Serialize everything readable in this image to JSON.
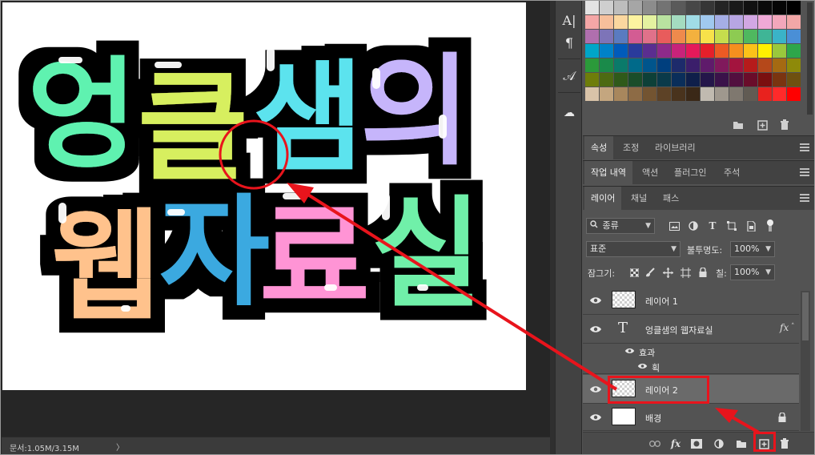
{
  "status": {
    "doc_info": "문서:1.05M/3.15M",
    "arrow": "〉"
  },
  "canvas": {
    "artwork": {
      "line1": [
        "엉",
        "클",
        "샘",
        "의"
      ],
      "line2": [
        "웹",
        "자",
        "료",
        "실"
      ],
      "colors": {
        "eong": "#5ef2b0",
        "keul": "#d7ef5f",
        "saem": "#5ce3ee",
        "ui": "#c6b5fb",
        "web": "#ffc28c",
        "ja": "#3aa9e0",
        "ryo": "#ff94d5",
        "sil": "#6ff0a9",
        "outline": "#000000",
        "shine": "#ffffff"
      }
    }
  },
  "mini_strip": {
    "items": [
      {
        "name": "character-panel-icon",
        "glyph": "A|"
      },
      {
        "name": "paragraph-panel-icon",
        "glyph": "¶"
      },
      {
        "name": "glyphs-panel-icon",
        "glyph": "𝒜"
      },
      {
        "name": "libraries-panel-icon",
        "glyph": "☁"
      }
    ]
  },
  "swatches": {
    "colors": [
      "#e3e3e3",
      "#cfcfcf",
      "#bdbdbd",
      "#a6a6a6",
      "#8c8c8c",
      "#737373",
      "#5a5a5a",
      "#474747",
      "#363636",
      "#242424",
      "#1a1a1a",
      "#111111",
      "#0a0a0a",
      "#050505",
      "#000000",
      "#f4a6a6",
      "#f7bf9b",
      "#fbd79f",
      "#fdf3a0",
      "#e4f2a0",
      "#b9e2a0",
      "#a4dcc0",
      "#a0dce6",
      "#a0c9ef",
      "#a5aee6",
      "#b7a6e3",
      "#d2a7e3",
      "#efa9d7",
      "#f3a7bb",
      "#f2a7a7",
      "#b06fae",
      "#7d74b8",
      "#5a7bc0",
      "#d35c93",
      "#e0718a",
      "#e85c5c",
      "#ef8a4c",
      "#f3b13e",
      "#f7e24a",
      "#c6dd4d",
      "#8dcb52",
      "#4fb85f",
      "#3fb596",
      "#3ab3c8",
      "#4a8fd6",
      "#00a6c8",
      "#0082c8",
      "#005bbb",
      "#2a3b9c",
      "#5b2e90",
      "#8e2a8a",
      "#c8237a",
      "#e5195a",
      "#e61f2b",
      "#ec5a24",
      "#f58f1f",
      "#fbc219",
      "#fff100",
      "#9ac83c",
      "#2ea64a",
      "#2b9a3a",
      "#1a8a4a",
      "#0a7a6a",
      "#006a8a",
      "#00558c",
      "#003f7e",
      "#1d2b6b",
      "#3b1e6b",
      "#5f1b6b",
      "#80195c",
      "#a3143e",
      "#b61b1b",
      "#b5481a",
      "#a56a12",
      "#8e8a0a",
      "#6e7d0a",
      "#4d6a12",
      "#2f5a1a",
      "#1a4d2a",
      "#0d4038",
      "#0a3a4a",
      "#0a2e5a",
      "#0f1f4a",
      "#24164a",
      "#3a124a",
      "#520f3f",
      "#6a0c2a",
      "#7a0f0f",
      "#7a3410",
      "#6e5010",
      "#d9c3a8",
      "#c4a67f",
      "#a8875d",
      "#8d6b45",
      "#735431",
      "#5d4226",
      "#49331d",
      "#3a2817",
      "#c0bab0",
      "#9f988e",
      "#7f786f",
      "#615b53",
      "#e8221e",
      "#ff2a2a",
      "#ff0000"
    ],
    "footer": [
      "new-group-icon",
      "new-swatch-icon",
      "delete-swatch-icon"
    ]
  },
  "tabs": {
    "group1": [
      "속성",
      "조정",
      "라이브러리"
    ],
    "group2": [
      "작업 내역",
      "액션",
      "플러그인",
      "주석"
    ],
    "group3": [
      "레이어",
      "채널",
      "패스"
    ]
  },
  "layers_panel": {
    "filter": {
      "label": "종류"
    },
    "blend": {
      "mode": "표준",
      "opacity_label": "불투명도:",
      "opacity": "100%"
    },
    "lock": {
      "label": "잠그기:",
      "fill_label": "칠:",
      "fill": "100%"
    },
    "layers": [
      {
        "name": "레이어 1",
        "type": "pixel"
      },
      {
        "name": "엉클샘의 웹자료실",
        "type": "text",
        "fx": "fx"
      },
      {
        "name": "효과",
        "type": "effect-group"
      },
      {
        "name": "획",
        "type": "effect"
      },
      {
        "name": "레이어 2",
        "type": "pixel"
      },
      {
        "name": "배경",
        "type": "background"
      }
    ]
  },
  "annotation": {
    "color": "#e8141c"
  }
}
